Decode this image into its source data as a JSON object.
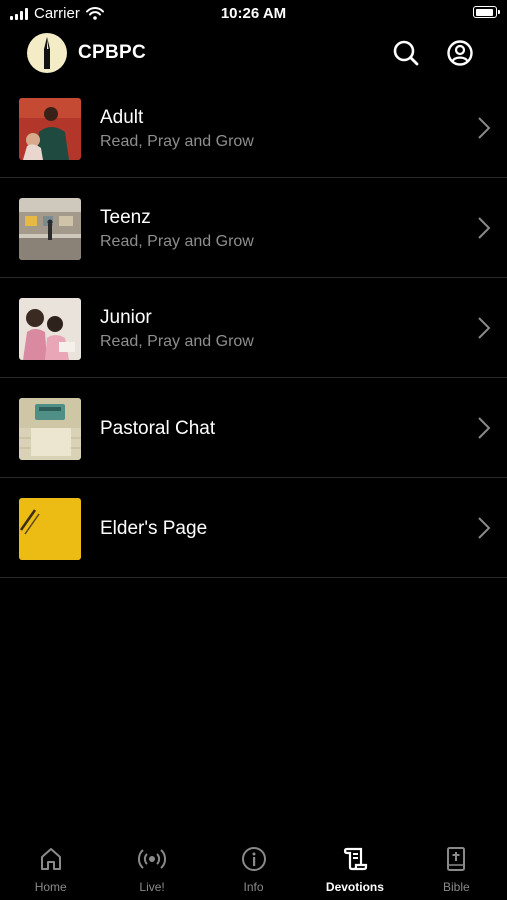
{
  "status_bar": {
    "carrier": "Carrier",
    "time": "10:26 AM",
    "battery_level": 0.95
  },
  "header": {
    "title": "CPBPC",
    "logo_icon": "church-steeple-logo",
    "search_icon": "search-icon",
    "account_icon": "account-circle-icon"
  },
  "items": [
    {
      "title": "Adult",
      "subtitle": "Read, Pray and Grow"
    },
    {
      "title": "Teenz",
      "subtitle": "Read, Pray and Grow"
    },
    {
      "title": "Junior",
      "subtitle": "Read, Pray and Grow"
    },
    {
      "title": "Pastoral Chat"
    },
    {
      "title": "Elder's Page"
    }
  ],
  "tabs": [
    {
      "label": "Home",
      "icon": "home-icon"
    },
    {
      "label": "Live!",
      "icon": "broadcast-icon"
    },
    {
      "label": "Info",
      "icon": "info-icon"
    },
    {
      "label": "Devotions",
      "icon": "scroll-icon",
      "active": true
    },
    {
      "label": "Bible",
      "icon": "bible-icon"
    }
  ],
  "colors": {
    "background": "#000000",
    "text": "#ffffff",
    "subtext": "#8e8e8e",
    "divider": "#2a2a2a",
    "tab_inactive": "#8a8a8a"
  }
}
